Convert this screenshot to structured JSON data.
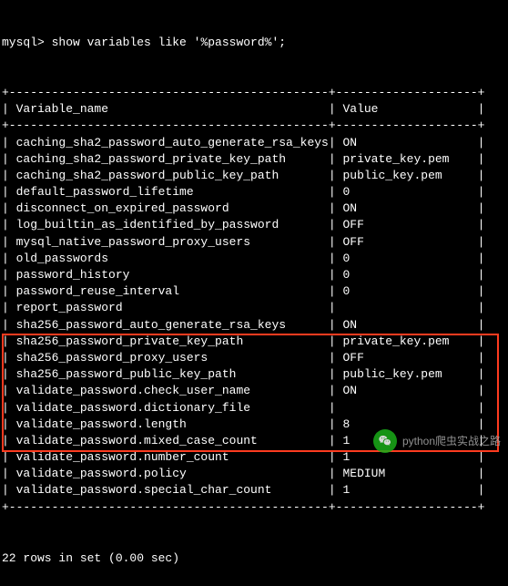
{
  "prompt": "mysql>",
  "command": "show variables like '%password%';",
  "header": {
    "name": "Variable_name",
    "value": "Value"
  },
  "rows": [
    {
      "name": "caching_sha2_password_auto_generate_rsa_keys",
      "value": "ON"
    },
    {
      "name": "caching_sha2_password_private_key_path",
      "value": "private_key.pem"
    },
    {
      "name": "caching_sha2_password_public_key_path",
      "value": "public_key.pem"
    },
    {
      "name": "default_password_lifetime",
      "value": "0"
    },
    {
      "name": "disconnect_on_expired_password",
      "value": "ON"
    },
    {
      "name": "log_builtin_as_identified_by_password",
      "value": "OFF"
    },
    {
      "name": "mysql_native_password_proxy_users",
      "value": "OFF"
    },
    {
      "name": "old_passwords",
      "value": "0"
    },
    {
      "name": "password_history",
      "value": "0"
    },
    {
      "name": "password_reuse_interval",
      "value": "0"
    },
    {
      "name": "report_password",
      "value": ""
    },
    {
      "name": "sha256_password_auto_generate_rsa_keys",
      "value": "ON"
    },
    {
      "name": "sha256_password_private_key_path",
      "value": "private_key.pem"
    },
    {
      "name": "sha256_password_proxy_users",
      "value": "OFF"
    },
    {
      "name": "sha256_password_public_key_path",
      "value": "public_key.pem"
    },
    {
      "name": "validate_password.check_user_name",
      "value": "ON"
    },
    {
      "name": "validate_password.dictionary_file",
      "value": ""
    },
    {
      "name": "validate_password.length",
      "value": "8"
    },
    {
      "name": "validate_password.mixed_case_count",
      "value": "1"
    },
    {
      "name": "validate_password.number_count",
      "value": "1"
    },
    {
      "name": "validate_password.policy",
      "value": "MEDIUM"
    },
    {
      "name": "validate_password.special_char_count",
      "value": "1"
    }
  ],
  "border": {
    "full": "+---------------------------------------------+--------------------+",
    "pipe": "|",
    "name_pad": 44,
    "value_pad": 19
  },
  "summary": "22 rows in set (0.00 sec)",
  "watermark": "python爬虫实战之路"
}
